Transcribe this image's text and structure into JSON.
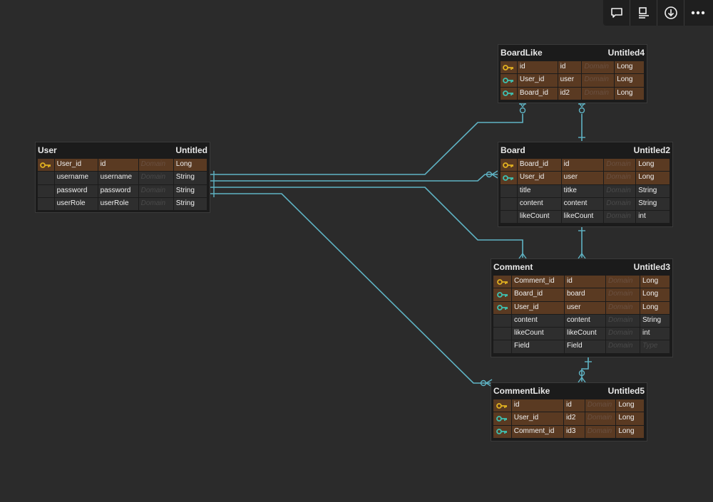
{
  "toolbar": {
    "buttons": [
      {
        "name": "comment-icon"
      },
      {
        "name": "properties-icon"
      },
      {
        "name": "download-icon"
      },
      {
        "name": "more-icon"
      }
    ]
  },
  "tables": {
    "user": {
      "name": "User",
      "label": "Untitled",
      "rows": [
        {
          "key": "gold",
          "col": "User_id",
          "attr": "id",
          "domain": "Domain",
          "type": "Long"
        },
        {
          "key": "",
          "col": "username",
          "attr": "username",
          "domain": "Domain",
          "type": "String"
        },
        {
          "key": "",
          "col": "password",
          "attr": "password",
          "domain": "Domain",
          "type": "String"
        },
        {
          "key": "",
          "col": "userRole",
          "attr": "userRole",
          "domain": "Domain",
          "type": "String"
        }
      ]
    },
    "boardlike": {
      "name": "BoardLike",
      "label": "Untitled4",
      "rows": [
        {
          "key": "gold",
          "col": "id",
          "attr": "id",
          "domain": "Domain",
          "type": "Long"
        },
        {
          "key": "teal",
          "col": "User_id",
          "attr": "user",
          "domain": "Domain",
          "type": "Long"
        },
        {
          "key": "teal",
          "col": "Board_id",
          "attr": "id2",
          "domain": "Domain",
          "type": "Long"
        }
      ]
    },
    "board": {
      "name": "Board",
      "label": "Untitled2",
      "rows": [
        {
          "key": "gold",
          "col": "Board_id",
          "attr": "id",
          "domain": "Domain",
          "type": "Long"
        },
        {
          "key": "teal",
          "col": "User_id",
          "attr": "user",
          "domain": "Domain",
          "type": "Long"
        },
        {
          "key": "",
          "col": "title",
          "attr": "titke",
          "domain": "Domain",
          "type": "String"
        },
        {
          "key": "",
          "col": "content",
          "attr": "content",
          "domain": "Domain",
          "type": "String"
        },
        {
          "key": "",
          "col": "likeCount",
          "attr": "likeCount",
          "domain": "Domain",
          "type": "int"
        }
      ]
    },
    "comment": {
      "name": "Comment",
      "label": "Untitled3",
      "rows": [
        {
          "key": "gold",
          "col": "Comment_id",
          "attr": "id",
          "domain": "Domain",
          "type": "Long"
        },
        {
          "key": "teal",
          "col": "Board_id",
          "attr": "board",
          "domain": "Domain",
          "type": "Long"
        },
        {
          "key": "teal",
          "col": "User_id",
          "attr": "user",
          "domain": "Domain",
          "type": "Long"
        },
        {
          "key": "",
          "col": "content",
          "attr": "content",
          "domain": "Domain",
          "type": "String"
        },
        {
          "key": "",
          "col": "likeCount",
          "attr": "likeCount",
          "domain": "Domain",
          "type": "int"
        },
        {
          "key": "",
          "col": "Field",
          "attr": "Field",
          "domain": "Domain",
          "type": "Type"
        }
      ]
    },
    "commentlike": {
      "name": "CommentLike",
      "label": "Untitled5",
      "rows": [
        {
          "key": "gold",
          "col": "id",
          "attr": "id",
          "domain": "Domain",
          "type": "Long"
        },
        {
          "key": "teal",
          "col": "User_id",
          "attr": "id2",
          "domain": "Domain",
          "type": "Long"
        },
        {
          "key": "teal",
          "col": "Comment_id",
          "attr": "id3",
          "domain": "Domain",
          "type": "Long"
        }
      ]
    }
  },
  "colors": {
    "background": "#2b2b2b",
    "connector": "#5fb3c4",
    "key_row": "#5a3a22",
    "plain_row": "#2e2e2e",
    "primary_key_icon": "#e0b020",
    "foreign_key_icon": "#3fc0b0"
  }
}
